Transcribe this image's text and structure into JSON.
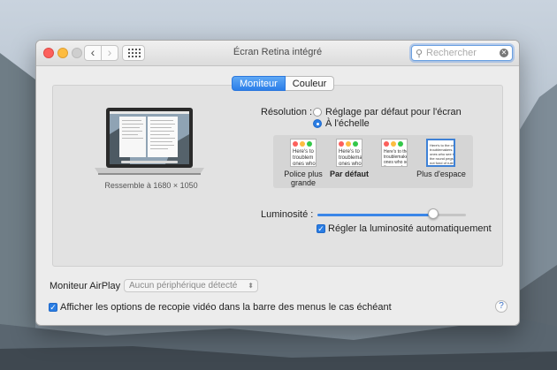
{
  "window": {
    "title": "Écran Retina intégré",
    "search_placeholder": "Rechercher"
  },
  "tabs": [
    {
      "label": "Moniteur",
      "selected": true
    },
    {
      "label": "Couleur",
      "selected": false
    }
  ],
  "display": {
    "resemble_label": "Ressemble à 1680 × 1050"
  },
  "resolution": {
    "label": "Résolution :",
    "options": [
      {
        "label": "Réglage par défaut pour l'écran",
        "selected": false
      },
      {
        "label": "À l'échelle",
        "selected": true
      }
    ],
    "scales": [
      {
        "caption": "Police plus grande",
        "preview_text": "Here's to\ntroublem\nones who",
        "selected": false,
        "bold": false
      },
      {
        "caption": "Par défaut",
        "preview_text": "Here's to t\ntroublemak\nones who s",
        "selected": false,
        "bold": true
      },
      {
        "caption": "",
        "preview_text": "Here's to the\ntroublemakers\nones who see\nthe round peg",
        "selected": false,
        "bold": false
      },
      {
        "caption": "Plus d'espace",
        "preview_text": "Here's to the cr\ntroublemakers.\nones who see thi\nthe round pegs.\nnot fond of rule",
        "selected": true,
        "bold": false
      }
    ]
  },
  "brightness": {
    "label": "Luminosité :",
    "value": 0.78,
    "auto_label": "Régler la luminosité automatiquement",
    "auto_checked": true
  },
  "airplay": {
    "label": "Moniteur AirPlay :",
    "value": "Aucun périphérique détecté"
  },
  "mirroring": {
    "label": "Afficher les options de recopie vidéo dans la barre des menus le cas échéant",
    "checked": true
  },
  "help_label": "?",
  "colors": {
    "accent": "#2a7de3",
    "close": "#fc605c",
    "minimize": "#fdbc40",
    "window_bg": "#ececec"
  }
}
